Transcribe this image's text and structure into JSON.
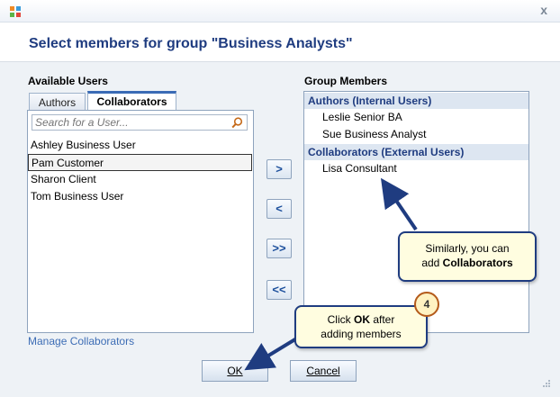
{
  "window": {
    "close_glyph": "x"
  },
  "dialog": {
    "title": "Select members for group \"Business Analysts\""
  },
  "available": {
    "label": "Available Users",
    "tabs": [
      {
        "label": "Authors",
        "active": false
      },
      {
        "label": "Collaborators",
        "active": true
      }
    ],
    "search_placeholder": "Search for a User...",
    "users": [
      "Ashley Business User",
      "Pam Customer",
      "Sharon Client",
      "Tom Business User"
    ],
    "selected_user": "Pam Customer"
  },
  "transfer_buttons": {
    "add_one": ">",
    "remove_one": "<",
    "add_all": ">>",
    "remove_all": "<<"
  },
  "members": {
    "label": "Group Members",
    "groups": [
      {
        "header": "Authors (Internal Users)",
        "items": [
          "Leslie Senior BA",
          "Sue Business Analyst"
        ]
      },
      {
        "header": "Collaborators (External Users)",
        "items": [
          "Lisa Consultant"
        ]
      }
    ]
  },
  "manage_link": "Manage Collaborators",
  "buttons": {
    "ok": "OK",
    "cancel": "Cancel"
  },
  "callouts": {
    "collab": {
      "line1": "Similarly, you can",
      "line2_prefix": "add ",
      "line2_bold": "Collaborators"
    },
    "ok": {
      "line1_prefix": "Click ",
      "line1_bold": "OK",
      "line1_suffix": " after",
      "line2": "adding members"
    },
    "step_number": "4"
  },
  "colors": {
    "title": "#1f3c80",
    "link": "#3d6db5",
    "callout_fill": "#fffde0",
    "callout_border": "#1f3c80",
    "badge_border": "#b45a1a"
  }
}
